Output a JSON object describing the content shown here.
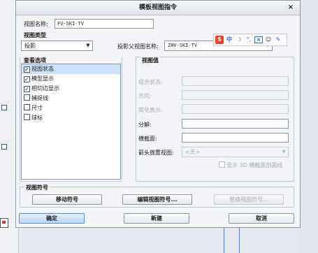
{
  "dialog": {
    "title": "模板视图指令",
    "close_glyph": "×"
  },
  "view_name": {
    "label": "视图名称:",
    "value": "FV-SKI-TV"
  },
  "view_type": {
    "section": "视图类型",
    "selected": "投影",
    "parent_label": "投影父视图名称:",
    "parent_value": "ZHV-SKI-TV"
  },
  "view_options": {
    "section": "查看选项",
    "items": [
      {
        "label": "视图状态",
        "checked": true,
        "selected": true
      },
      {
        "label": "模型显示",
        "checked": true,
        "selected": false
      },
      {
        "label": "相切边显示",
        "checked": true,
        "selected": false
      },
      {
        "label": "捕捉线",
        "checked": false,
        "selected": false
      },
      {
        "label": "尺寸",
        "checked": false,
        "selected": false
      },
      {
        "label": "球标",
        "checked": false,
        "selected": false
      }
    ]
  },
  "view_values": {
    "section": "视图值",
    "combo_state": "组合状态:",
    "direction": "方向:",
    "simplified": "简化表示:",
    "explode": "分解:",
    "cross_section": "横截面:",
    "arrow_view_label": "箭头放置视图:",
    "arrow_view_value": "<无>",
    "show_3d_label": "显示 3D 横截面剖面线"
  },
  "view_symbol": {
    "section": "视图符号",
    "move": "移动符号",
    "edit": "编辑视图符号...",
    "replace": "替换视图符号..."
  },
  "footer": {
    "ok": "确定",
    "new": "新建",
    "cancel": "取消"
  },
  "ime_toolbar": {
    "logo": "S",
    "mode": "中",
    "icons": [
      "moon-icon",
      "dot-icon",
      "keyboard-icon",
      "user-icon",
      "tool-icon"
    ]
  }
}
